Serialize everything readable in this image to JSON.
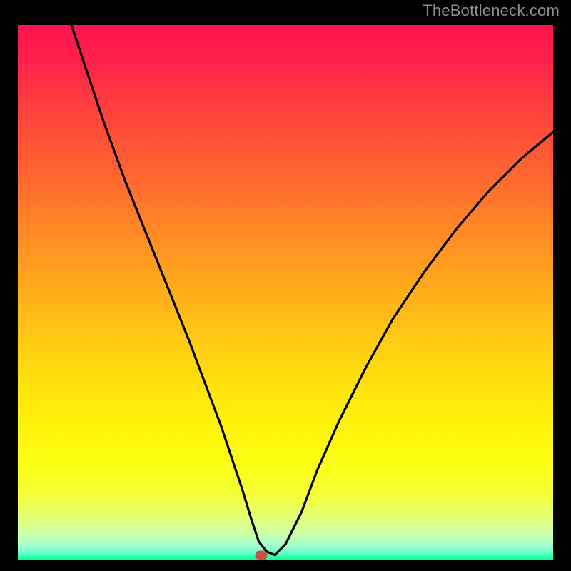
{
  "watermark": "TheBottleneck.com",
  "marker": {
    "x_pct": 45.5,
    "y_pct": 99.0
  },
  "chart_data": {
    "type": "line",
    "title": "",
    "xlabel": "",
    "ylabel": "",
    "xlim": [
      0,
      100
    ],
    "ylim": [
      0,
      100
    ],
    "grid": false,
    "legend": false,
    "series": [
      {
        "name": "bottleneck-curve",
        "x": [
          10,
          13,
          16,
          20,
          24,
          28,
          32,
          35,
          38,
          40,
          42,
          43.5,
          45,
          46.5,
          48,
          50,
          53,
          56,
          60,
          65,
          70,
          76,
          82,
          88,
          94,
          100
        ],
        "y": [
          100,
          91,
          82,
          71,
          61,
          51,
          41,
          33,
          25,
          19,
          13,
          8,
          3.5,
          1.6,
          1.0,
          3,
          9,
          17,
          26,
          36,
          45,
          54,
          62,
          69,
          75,
          80
        ]
      }
    ],
    "annotations": [
      {
        "type": "flat-segment",
        "x_start": 43.5,
        "x_end": 48,
        "y": 1.0
      },
      {
        "type": "marker",
        "x": 45.5,
        "y": 1.0,
        "color": "#c6554a"
      }
    ],
    "background_gradient": {
      "direction": "vertical",
      "stops": [
        {
          "pos": 0.0,
          "color": "#ff1450"
        },
        {
          "pos": 0.5,
          "color": "#ffbb17"
        },
        {
          "pos": 0.8,
          "color": "#fcff13"
        },
        {
          "pos": 1.0,
          "color": "#00ff91"
        }
      ]
    }
  }
}
